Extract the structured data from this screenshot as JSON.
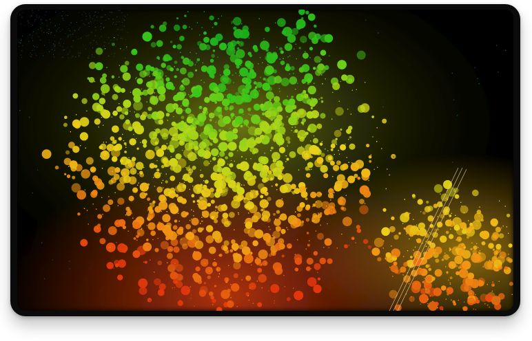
{
  "image": {
    "subject": "lidar-point-cloud",
    "colors": {
      "background": "#000000",
      "high": "#1fc21a",
      "mid_high": "#8fd41c",
      "mid": "#e6d218",
      "mid_low": "#f29a14",
      "low": "#e8420e",
      "blue_noise": "#2a6f8a"
    }
  }
}
